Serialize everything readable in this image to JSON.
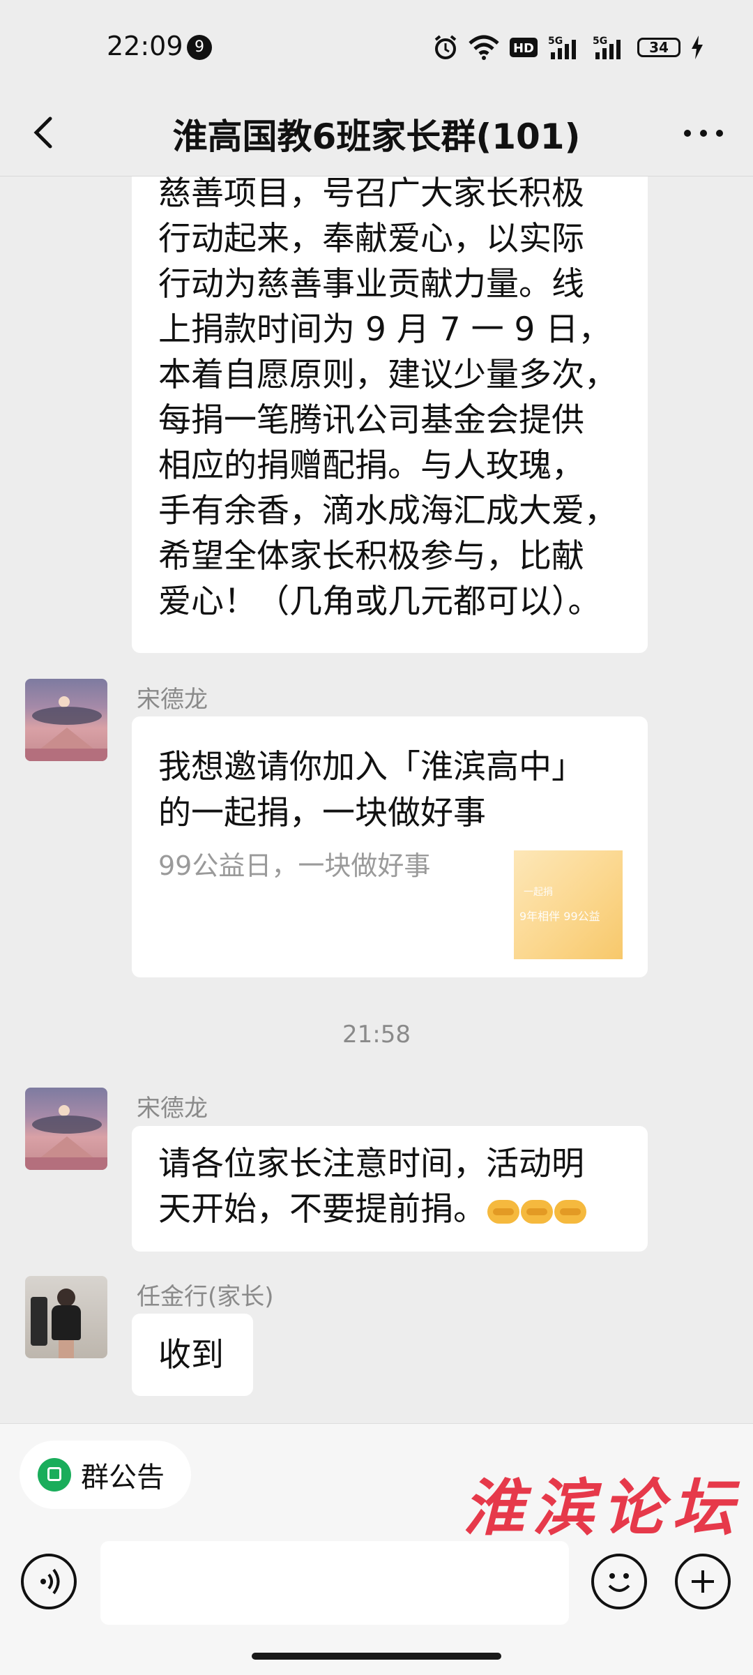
{
  "status_bar": {
    "time": "22:09",
    "notification_count": "9",
    "network_1": "5G",
    "network_2": "5G",
    "battery": "34"
  },
  "header": {
    "title": "淮高国教6班家长群(101)"
  },
  "messages": [
    {
      "type": "text",
      "lines": [
        "慈善项目，号召广大家长积极",
        "行动起来，奉献爱心，以实际",
        "行动为慈善事业贡献力量。线",
        "上捐款时间为 9 月 7 一 9 日，",
        "本着自愿原则，建议少量多次，",
        "每捐一笔腾讯公司基金会提供",
        "相应的捐赠配捐。与人玫瑰，",
        "手有余香，滴水成海汇成大爱，",
        "希望全体家长积极参与，比献",
        "爱心！（几角或几元都可以）。"
      ]
    },
    {
      "type": "card",
      "sender": "宋德龙",
      "title_line1": "我想邀请你加入「淮滨高中」",
      "title_line2": "的一起捐，一块做好事",
      "description": "99公益日，一块做好事",
      "thumb_text_1": "一起捐",
      "thumb_text_2": "9年相伴 99公益"
    },
    {
      "type": "timestamp",
      "text": "21:58"
    },
    {
      "type": "text",
      "sender": "宋德龙",
      "line1": "请各位家长注意时间，活动明",
      "line2": "天开始，不要提前捐。"
    },
    {
      "type": "text",
      "sender": "任金行(家长)",
      "text": "收到"
    }
  ],
  "bottom": {
    "notice_label": "群公告",
    "watermark": "淮滨论坛"
  }
}
